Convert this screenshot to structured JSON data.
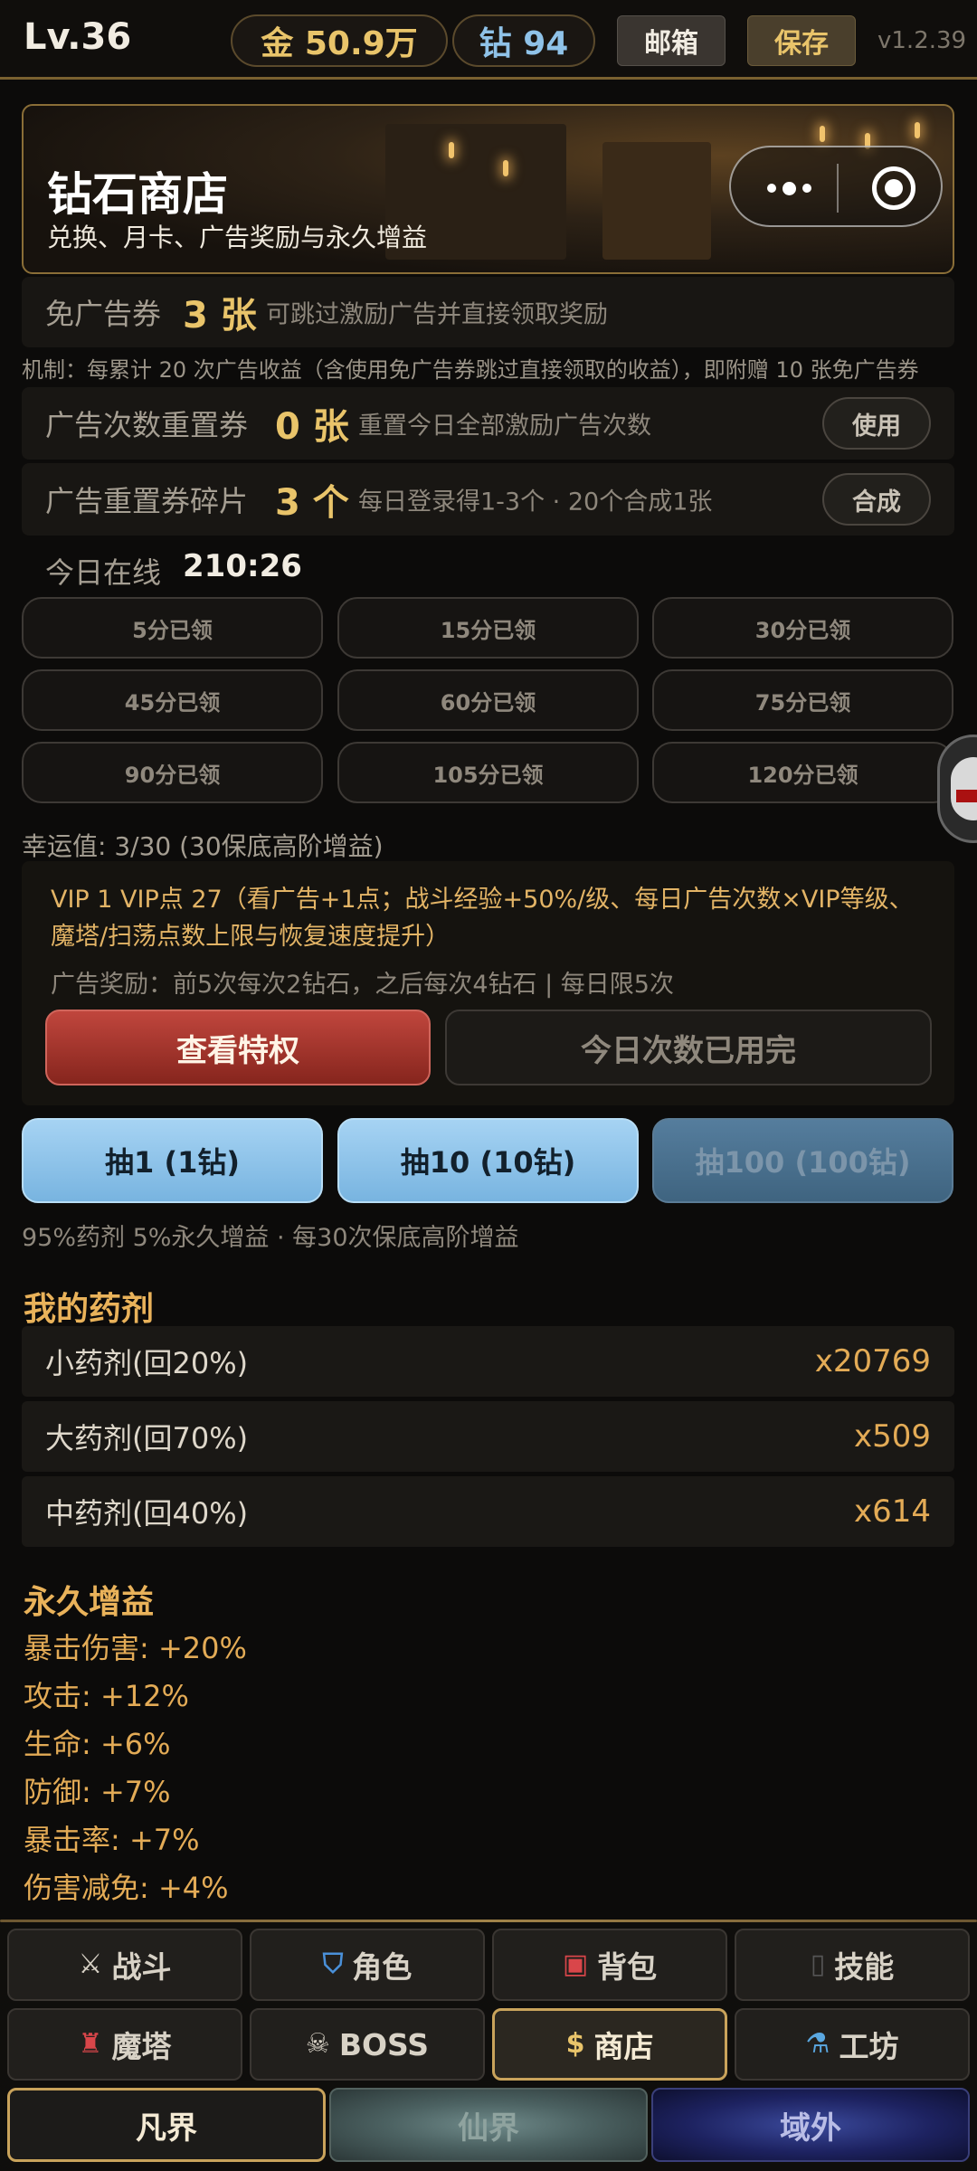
{
  "header": {
    "level": "Lv.36",
    "gold": "金 50.9万",
    "diamond": "钻 94",
    "mail_label": "邮箱",
    "save_label": "保存",
    "version": "v1.2.39"
  },
  "banner": {
    "title": "钻石商店",
    "subtitle": "兑换、月卡、广告奖励与永久增益"
  },
  "tickets": {
    "adfree_label": "免广告券",
    "adfree_value": "3 张",
    "adfree_desc": "可跳过激励广告并直接领取奖励",
    "mechanism": "机制：每累计 20 次广告收益（含使用免广告券跳过直接领取的收益），即附赠 10 张免广告券",
    "reset_label": "广告次数重置券",
    "reset_value": "0 张",
    "reset_desc": "重置今日全部激励广告次数",
    "reset_btn": "使用",
    "fragment_label": "广告重置券碎片",
    "fragment_value": "3 个",
    "fragment_desc": "每日登录得1-3个 · 20个合成1张",
    "fragment_btn": "合成"
  },
  "online": {
    "label": "今日在线",
    "time": "210:26",
    "rewards": [
      "5分已领",
      "15分已领",
      "30分已领",
      "45分已领",
      "60分已领",
      "75分已领",
      "90分已领",
      "105分已领",
      "120分已领"
    ]
  },
  "luck": "幸运值: 3/30 (30保底高阶增益)",
  "vip": {
    "text": "VIP 1  VIP点 27（看广告+1点；战斗经验+50%/级、每日广告次数×VIP等级、魔塔/扫荡点数上限与恢复速度提升）",
    "ad_reward": "广告奖励：前5次每次2钻石，之后每次4钻石 | 每日限5次",
    "privilege_btn": "查看特权",
    "used_btn": "今日次数已用完"
  },
  "draw": {
    "one": "抽1 (1钻)",
    "ten": "抽10 (10钻)",
    "hundred": "抽100 (100钻)",
    "note": "95%药剂 5%永久增益 · 每30次保底高阶增益"
  },
  "potions": {
    "title": "我的药剂",
    "items": [
      {
        "name": "小药剂(回20%)",
        "count": "x20769"
      },
      {
        "name": "大药剂(回70%)",
        "count": "x509"
      },
      {
        "name": "中药剂(回40%)",
        "count": "x614"
      }
    ]
  },
  "buffs": {
    "title": "永久增益",
    "items": [
      "暴击伤害: +20%",
      "攻击: +12%",
      "生命: +6%",
      "防御: +7%",
      "暴击率: +7%",
      "伤害减免: +4%"
    ]
  },
  "nav": {
    "battle": "战斗",
    "character": "角色",
    "bag": "背包",
    "skills": "技能",
    "tower": "魔塔",
    "boss": "BOSS",
    "shop": "商店",
    "workshop": "工坊"
  },
  "realms": {
    "mortal": "凡界",
    "immortal": "仙界",
    "outer": "域外"
  }
}
